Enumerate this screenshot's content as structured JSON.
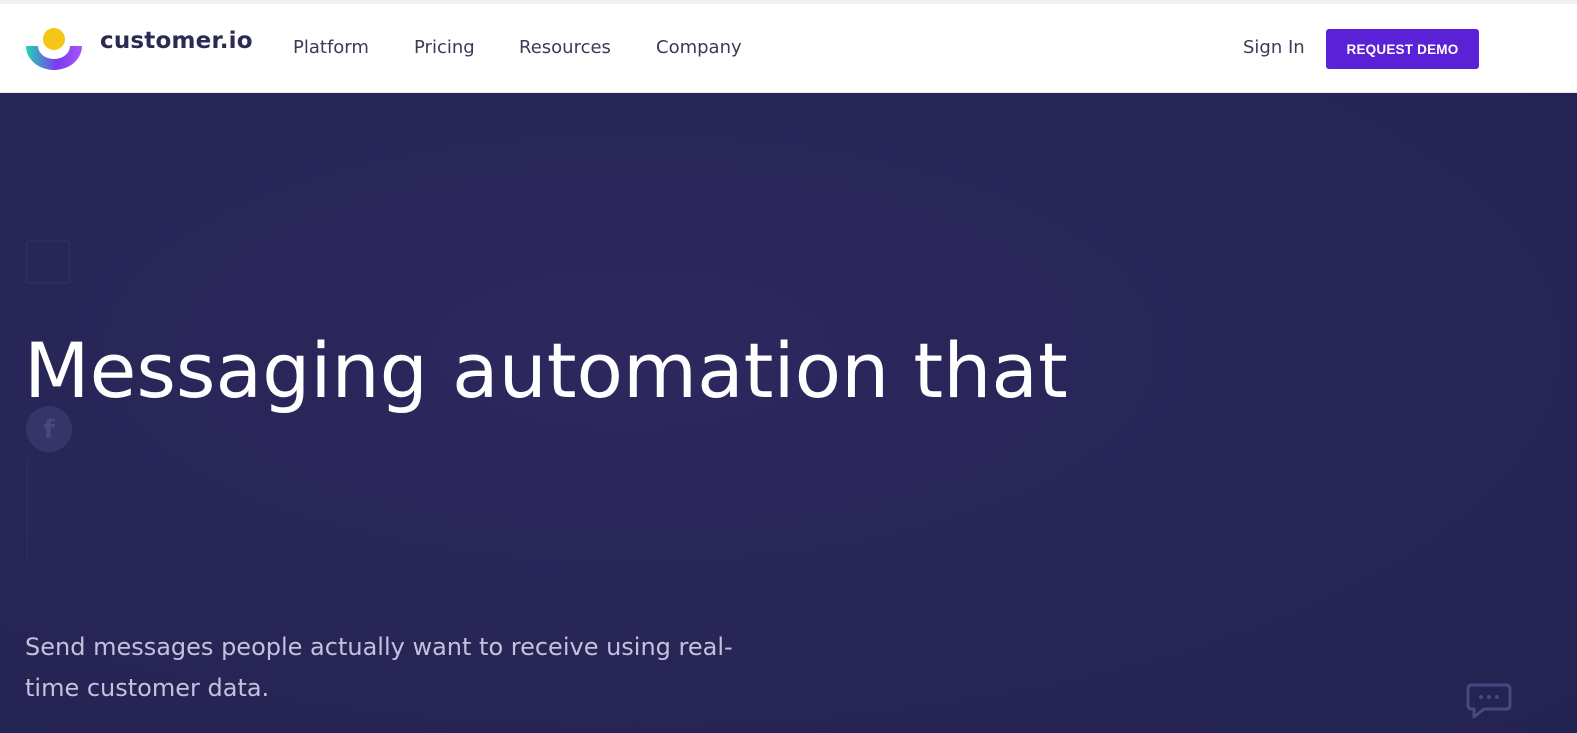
{
  "header": {
    "brand": "customer.io",
    "nav": {
      "platform": "Platform",
      "pricing": "Pricing",
      "resources": "Resources",
      "company": "Company"
    },
    "sign_in": "Sign In",
    "request_demo": "REQUEST DEMO"
  },
  "hero": {
    "headline": "Messaging automation that",
    "subtext": "Send messages people actually want to receive using real-time customer data."
  },
  "icons": {
    "logo": "customer-io-logo-icon",
    "facebook": "facebook-icon",
    "chat": "chat-icon"
  },
  "colors": {
    "brand_purple": "#5b21d6",
    "hero_bg": "#282657",
    "logo_yellow": "#f5c518",
    "logo_teal": "#22d3b5",
    "logo_violet": "#a855f7"
  }
}
